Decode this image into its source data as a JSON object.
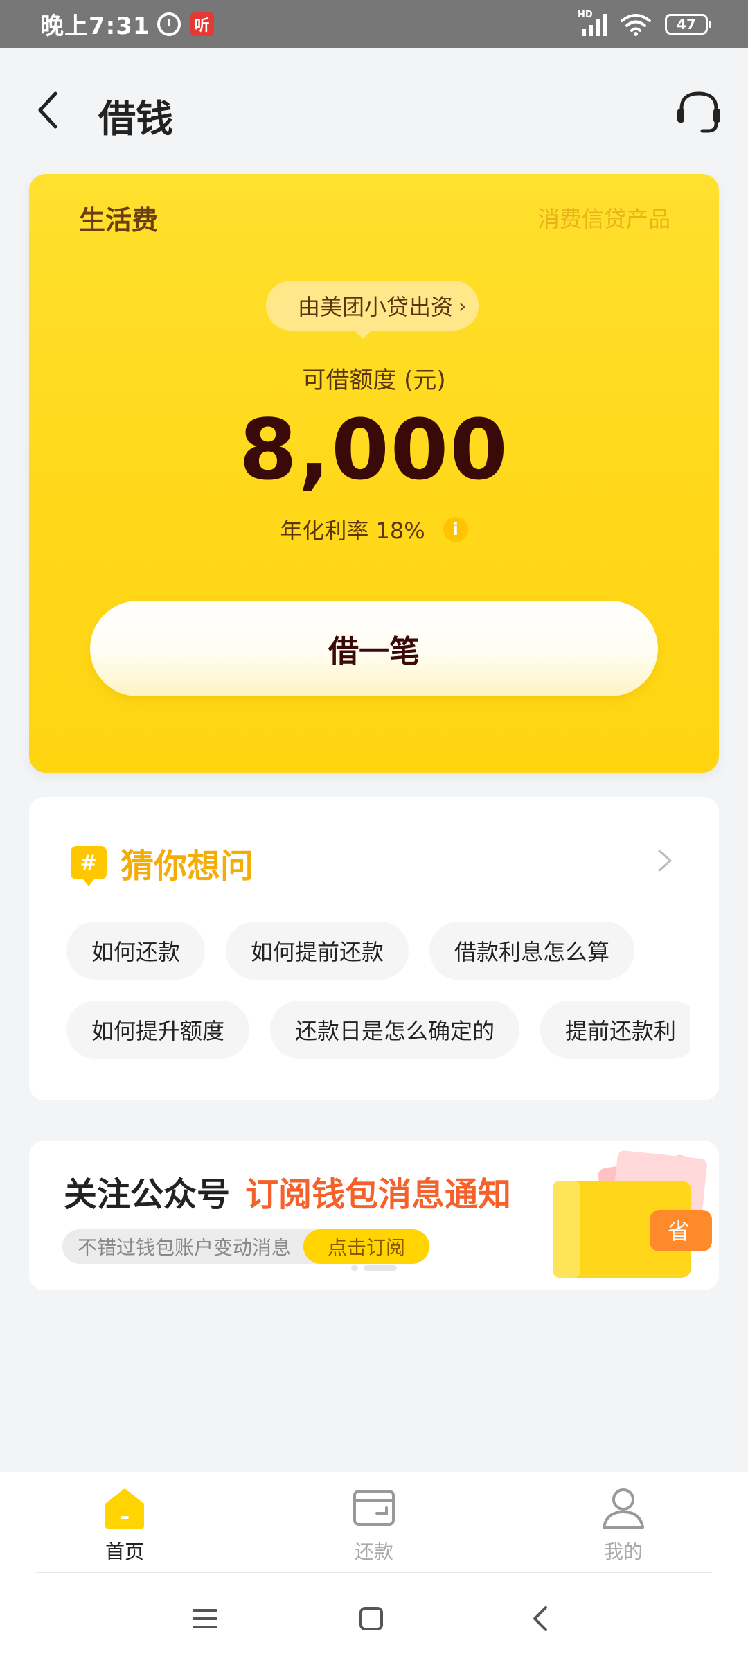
{
  "status_bar": {
    "time": "晚上7:31",
    "listen_badge": "听",
    "network": "HD",
    "battery": "47"
  },
  "header": {
    "title": "借钱"
  },
  "loan_card": {
    "label": "生活费",
    "product_type": "消费信贷产品",
    "lender": "由美团小贷出资",
    "amount_label": "可借额度 (元)",
    "amount": "8,000",
    "rate": "年化利率 18%",
    "borrow_button": "借一笔"
  },
  "faq": {
    "title": "猜你想问",
    "row1": [
      "如何还款",
      "如何提前还款",
      "借款利息怎么算"
    ],
    "row2": [
      "如何提升额度",
      "还款日是怎么确定的",
      "提前还款利"
    ]
  },
  "banner": {
    "title_prefix": "关注公众号",
    "title_highlight": "订阅钱包消息通知",
    "subtitle": "不错过钱包账户变动消息",
    "subscribe_button": "点击订阅",
    "wallet_badge": "省"
  },
  "tabbar": {
    "home": "首页",
    "repay": "还款",
    "mine": "我的"
  },
  "colors": {
    "brand_yellow": "#ffd81a",
    "accent_orange": "#f5612b",
    "faq_title": "#f3ad06"
  }
}
